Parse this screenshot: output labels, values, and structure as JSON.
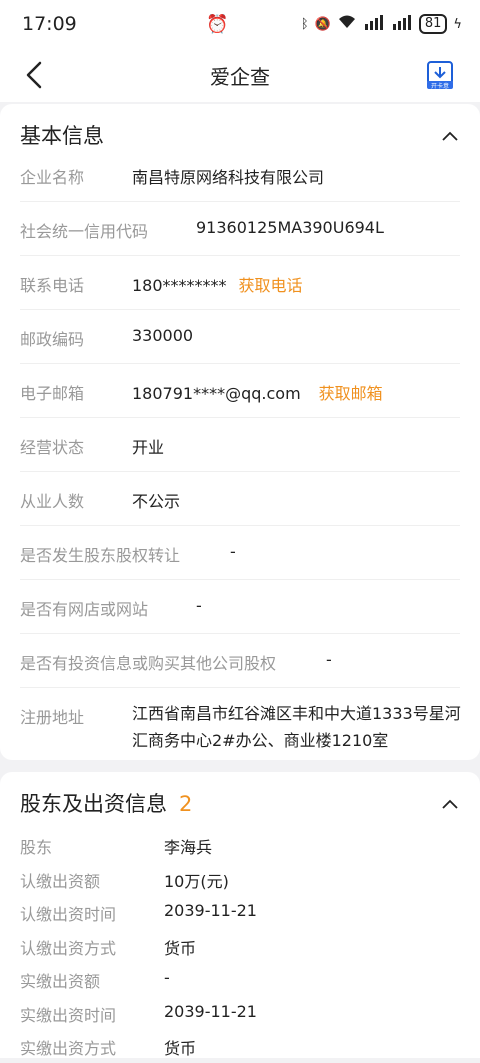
{
  "status_bar": {
    "time": "17:09",
    "battery": "81"
  },
  "nav": {
    "title": "爱企查",
    "report_label": "开卡意"
  },
  "basic_info": {
    "title": "基本信息",
    "rows": [
      {
        "label": "企业名称",
        "value": "南昌特原网络科技有限公司"
      },
      {
        "label": "社会统一信用代码",
        "value": "91360125MA390U694L"
      },
      {
        "label": "联系电话",
        "value": "180********",
        "action": "获取电话"
      },
      {
        "label": "邮政编码",
        "value": "330000"
      },
      {
        "label": "电子邮箱",
        "value": "180791****@qq.com",
        "action": "获取邮箱"
      },
      {
        "label": "经营状态",
        "value": "开业"
      },
      {
        "label": "从业人数",
        "value": "不公示"
      },
      {
        "label": "是否发生股东股权转让",
        "value": "-"
      },
      {
        "label": "是否有网店或网站",
        "value": "-"
      },
      {
        "label": "是否有投资信息或购买其他公司股权",
        "value": "-"
      },
      {
        "label": "注册地址",
        "value": "江西省南昌市红谷滩区丰和中大道1333号星河汇商务中心2#办公、商业楼1210室"
      }
    ]
  },
  "shareholders": {
    "title": "股东及出资信息",
    "count": "2",
    "rows": [
      {
        "label": "股东",
        "value": "李海兵"
      },
      {
        "label": "认缴出资额",
        "value": "10万(元)"
      },
      {
        "label": "认缴出资时间",
        "value": "2039-11-21"
      },
      {
        "label": "认缴出资方式",
        "value": "货币"
      },
      {
        "label": "实缴出资额",
        "value": "-"
      },
      {
        "label": "实缴出资时间",
        "value": "2039-11-21"
      },
      {
        "label": "实缴出资方式",
        "value": "货币"
      }
    ]
  }
}
